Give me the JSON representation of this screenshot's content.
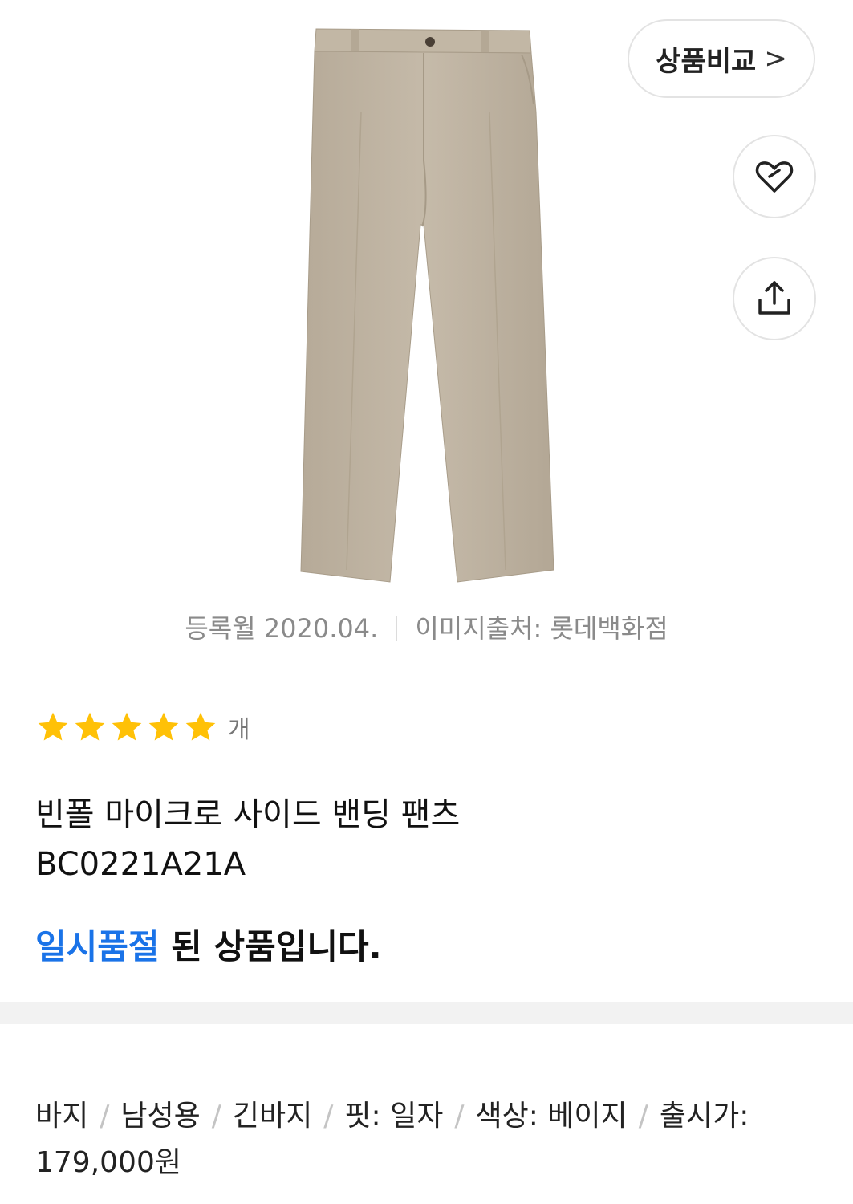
{
  "header": {
    "compare_label": "상품비교",
    "compare_chevron": ">",
    "wish_icon": "heart-plus-icon",
    "share_icon": "share-icon"
  },
  "image": {
    "registered": "등록월 2020.04.",
    "source": "이미지출처: 롯데백화점"
  },
  "rating": {
    "stars": 5,
    "unit": "개",
    "star_color": "#ffc107"
  },
  "product": {
    "name_line1": "빈폴 마이크로 사이드 밴딩 팬츠",
    "name_line2": "BC0221A21A"
  },
  "status": {
    "highlight": "일시품절",
    "rest": " 된 상품입니다.",
    "highlight_color": "#1a73e8"
  },
  "specs": {
    "items": [
      "바지",
      "남성용",
      "긴바지",
      "핏: 일자",
      "색상: 베이지",
      "출시가: 179,000원"
    ]
  }
}
